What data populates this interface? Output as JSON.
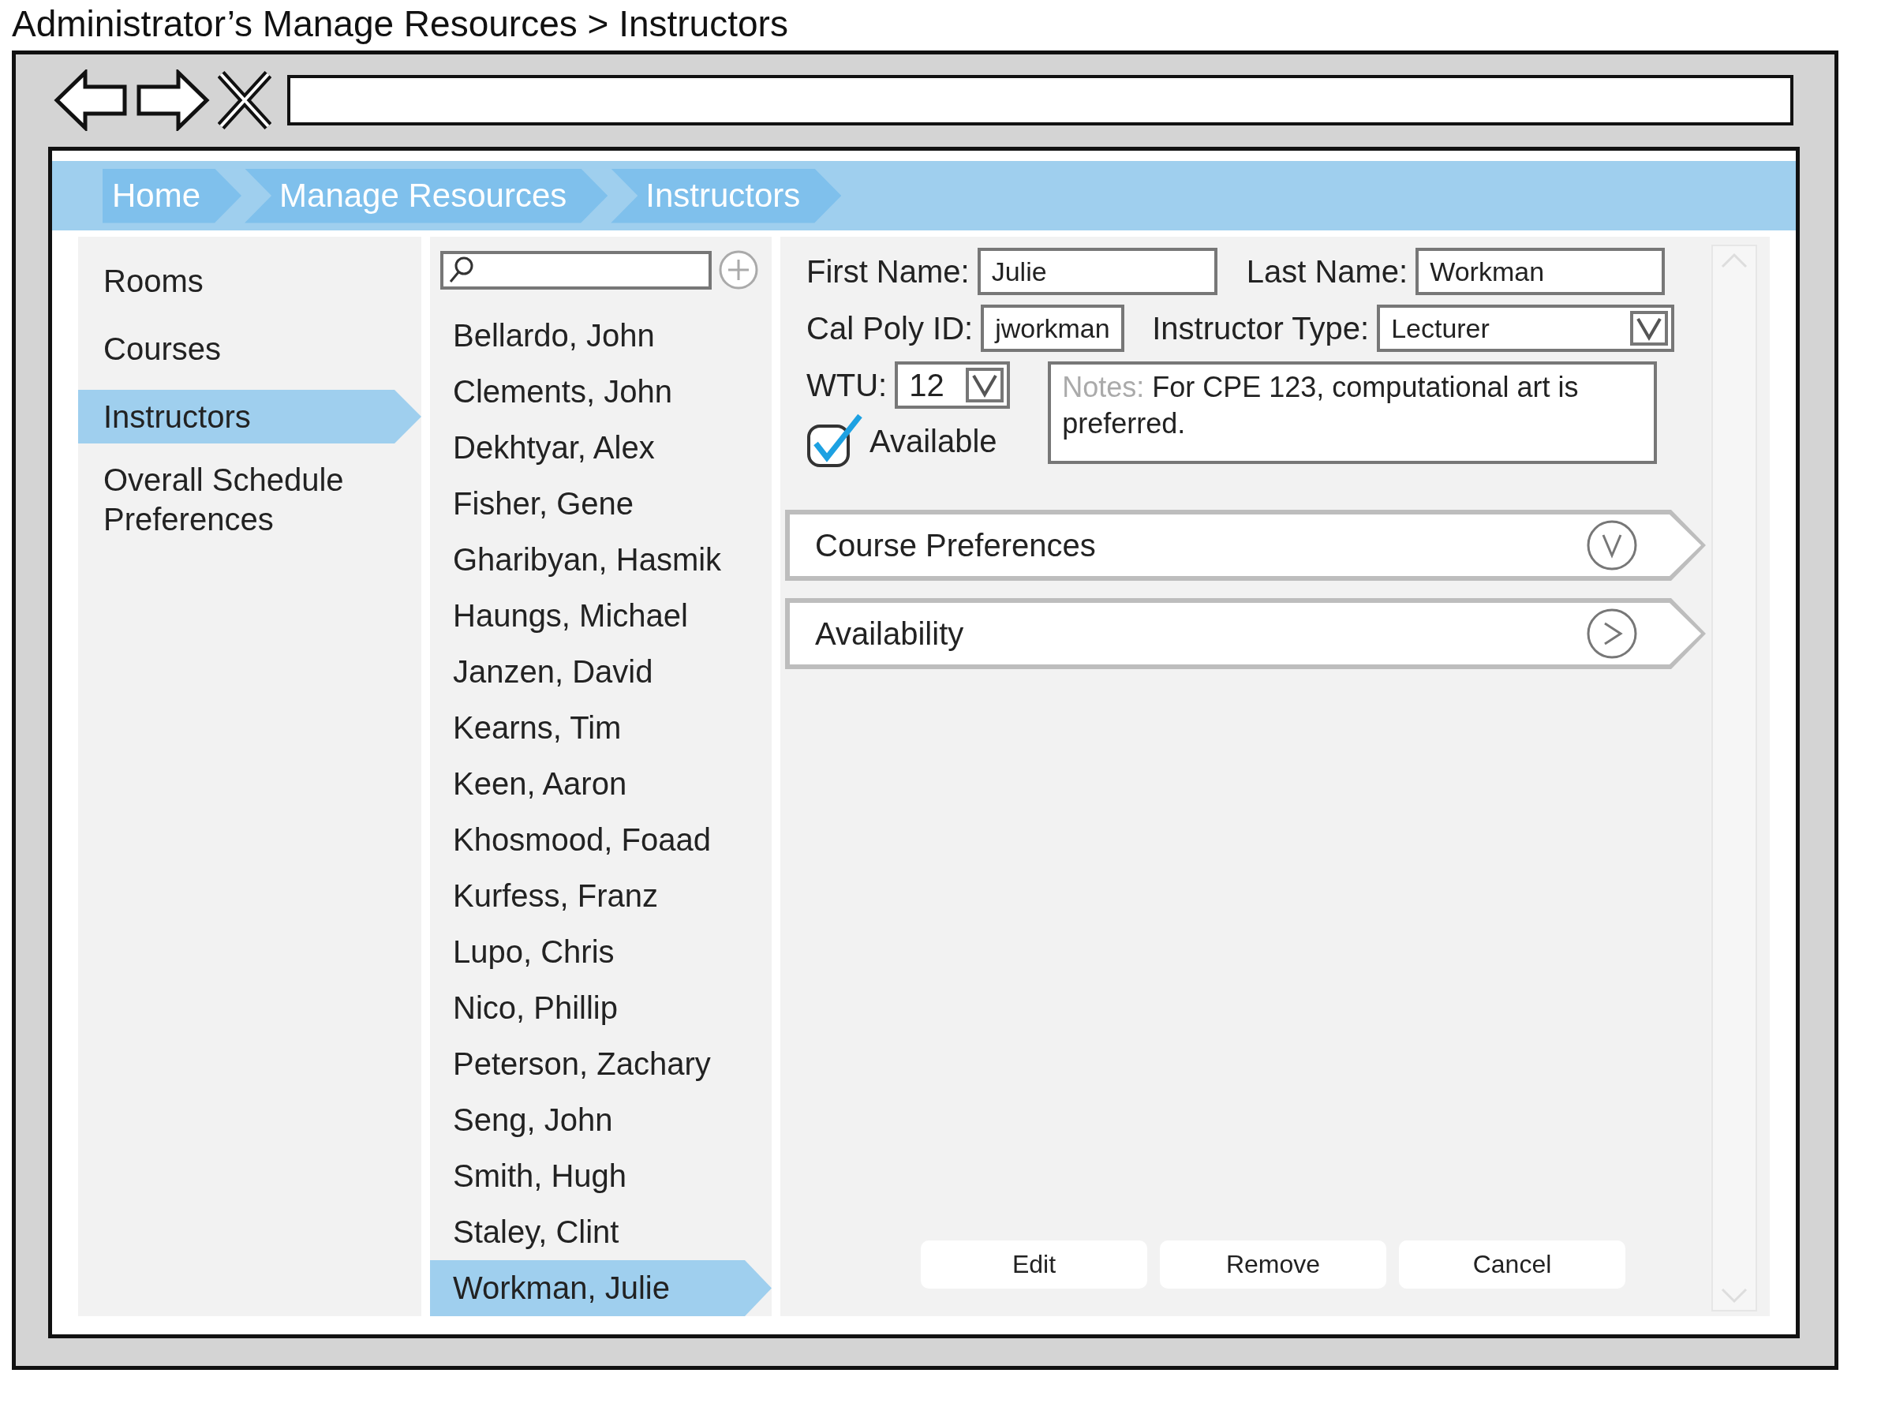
{
  "page_title": "Administrator’s Manage Resources > Instructors",
  "breadcrumbs": [
    {
      "label": "Home"
    },
    {
      "label": "Manage Resources"
    },
    {
      "label": "Instructors"
    }
  ],
  "sidebar": {
    "items": [
      {
        "label": "Rooms",
        "selected": false
      },
      {
        "label": "Courses",
        "selected": false
      },
      {
        "label": "Instructors",
        "selected": true
      },
      {
        "label": "Overall Schedule Preferences",
        "selected": false
      }
    ]
  },
  "instructor_list": {
    "items": [
      {
        "label": "Bellardo, John",
        "selected": false
      },
      {
        "label": "Clements, John",
        "selected": false
      },
      {
        "label": "Dekhtyar, Alex",
        "selected": false
      },
      {
        "label": "Fisher, Gene",
        "selected": false
      },
      {
        "label": "Gharibyan, Hasmik",
        "selected": false
      },
      {
        "label": "Haungs, Michael",
        "selected": false
      },
      {
        "label": "Janzen, David",
        "selected": false
      },
      {
        "label": "Kearns, Tim",
        "selected": false
      },
      {
        "label": "Keen, Aaron",
        "selected": false
      },
      {
        "label": "Khosmood, Foaad",
        "selected": false
      },
      {
        "label": "Kurfess, Franz",
        "selected": false
      },
      {
        "label": "Lupo, Chris",
        "selected": false
      },
      {
        "label": "Nico, Phillip",
        "selected": false
      },
      {
        "label": "Peterson, Zachary",
        "selected": false
      },
      {
        "label": "Seng, John",
        "selected": false
      },
      {
        "label": "Smith, Hugh",
        "selected": false
      },
      {
        "label": "Staley, Clint",
        "selected": false
      },
      {
        "label": "Workman, Julie",
        "selected": true
      }
    ]
  },
  "form": {
    "first_name": {
      "label": "First Name:",
      "value": "Julie"
    },
    "last_name": {
      "label": "Last Name:",
      "value": "Workman"
    },
    "cal_poly_id": {
      "label": "Cal Poly ID:",
      "value": "jworkman"
    },
    "instructor_type": {
      "label": "Instructor Type:",
      "value": "Lecturer"
    },
    "wtu": {
      "label": "WTU:",
      "value": "12"
    },
    "available": {
      "label": "Available",
      "checked": true
    },
    "notes": {
      "label": "Notes:",
      "value": "For CPE 123, computational art is preferred."
    }
  },
  "sections": [
    {
      "label": "Course Preferences",
      "expanded": true
    },
    {
      "label": "Availability",
      "expanded": false
    }
  ],
  "buttons": [
    {
      "label": "Edit"
    },
    {
      "label": "Remove"
    },
    {
      "label": "Cancel"
    }
  ]
}
